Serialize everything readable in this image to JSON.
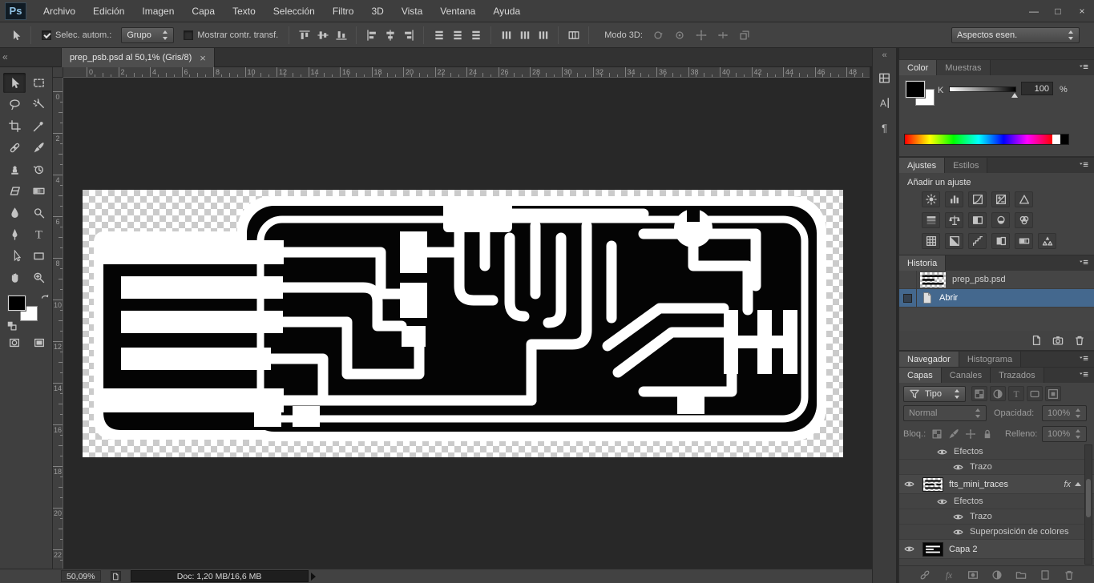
{
  "titlebar": {
    "logo": "Ps",
    "menus": [
      "Archivo",
      "Edición",
      "Imagen",
      "Capa",
      "Texto",
      "Selección",
      "Filtro",
      "3D",
      "Vista",
      "Ventana",
      "Ayuda"
    ],
    "controls": {
      "minimize": "—",
      "restore": "□",
      "close": "×"
    }
  },
  "options": {
    "auto_select_label": "Selec. autom.:",
    "auto_select_checked": true,
    "group_value": "Grupo",
    "show_transform_label": "Mostrar contr. transf.",
    "show_transform_checked": false,
    "align_icons": [
      "align-top",
      "align-middle",
      "align-bottom",
      "align-left",
      "align-center",
      "align-right",
      "dist-top",
      "dist-middle",
      "dist-bottom",
      "dist-left",
      "dist-center",
      "dist-right"
    ],
    "auto_align_icon": "auto-align",
    "mode3d_label": "Modo 3D:",
    "mode3d_icons": [
      "3d-orbit",
      "3d-roll",
      "3d-pan",
      "3d-slide",
      "3d-scale"
    ],
    "workspace_value": "Aspectos esen."
  },
  "doc_tab": {
    "title": "prep_psb.psd al 50,1% (Gris/8)",
    "close": "×"
  },
  "collapse_glyph": "«",
  "toolbar": {
    "tools": [
      "move",
      "marquee",
      "lasso",
      "wand",
      "crop",
      "eyedropper",
      "healing",
      "brush",
      "stamp",
      "history-brush",
      "eraser",
      "gradient",
      "blur",
      "dodge",
      "pen",
      "type",
      "path-select",
      "shape",
      "hand",
      "zoom"
    ],
    "bottom_icons": [
      "quick-mask",
      "screen-mode"
    ]
  },
  "rulers": {
    "horizontal": [
      "0",
      "2",
      "4",
      "6",
      "8",
      "10",
      "12",
      "14",
      "16",
      "18",
      "20",
      "22",
      "24",
      "26",
      "28",
      "30",
      "32",
      "34",
      "36",
      "38",
      "40",
      "42",
      "44",
      "46",
      "48"
    ],
    "vertical": [
      "0",
      "2",
      "4",
      "6",
      "8",
      "10",
      "12",
      "14",
      "16",
      "18",
      "20",
      "22"
    ]
  },
  "statusbar": {
    "zoom": "50,09%",
    "doc_info": "Doc: 1,20 MB/16,6 MB"
  },
  "dock_strip": {
    "icons": [
      "panel-grid",
      "character-panel",
      "paragraph-panel"
    ]
  },
  "color_panel": {
    "tabs": [
      "Color",
      "Muestras"
    ],
    "channel_label": "K",
    "value": "100",
    "unit": "%"
  },
  "adjustments_panel": {
    "tabs": [
      "Ajustes",
      "Estilos"
    ],
    "heading": "Añadir un ajuste",
    "icons_row1": [
      "brightness-contrast",
      "levels",
      "curves",
      "exposure",
      "vibrance"
    ],
    "icons_row2": [
      "hue-saturation",
      "color-balance",
      "black-white",
      "photo-filter",
      "channel-mixer"
    ],
    "icons_row3": [
      "color-lookup",
      "invert",
      "posterize",
      "threshold",
      "gradient-map",
      "selective-color"
    ]
  },
  "history_panel": {
    "title": "Historia",
    "items": [
      {
        "label": "prep_psb.psd",
        "type": "snapshot",
        "selected": false
      },
      {
        "label": "Abrir",
        "type": "state",
        "selected": true
      }
    ],
    "footer_icons": [
      "new-doc-from-state",
      "new-snapshot",
      "delete"
    ]
  },
  "navigator_bar": {
    "tabs": [
      "Navegador",
      "Histograma"
    ]
  },
  "layers_panel": {
    "tabs": [
      "Capas",
      "Canales",
      "Trazados"
    ],
    "filter": {
      "label": "Tipo",
      "icons": [
        "pixel-filter",
        "adjustment-filter",
        "type-filter",
        "shape-filter",
        "smart-filter"
      ]
    },
    "blend_mode": "Normal",
    "opacity_label": "Opacidad:",
    "opacity_value": "100%",
    "lock_label": "Bloq.:",
    "lock_icons": [
      "lock-transparent",
      "lock-pixels",
      "lock-position",
      "lock-all"
    ],
    "fill_label": "Relleno:",
    "fill_value": "100%",
    "fx_badge": "fx",
    "rows": [
      {
        "type": "effects",
        "label": "Efectos"
      },
      {
        "type": "effect-item",
        "label": "Trazo"
      },
      {
        "type": "layer",
        "label": "fts_mini_traces",
        "thumb": "traces",
        "fx": true
      },
      {
        "type": "effects",
        "label": "Efectos"
      },
      {
        "type": "effect-item",
        "label": "Trazo"
      },
      {
        "type": "effect-item",
        "label": "Superposición de colores"
      },
      {
        "type": "layer",
        "label": "Capa 2",
        "thumb": "dark",
        "fx": false
      }
    ],
    "footer_icons": [
      "link-layers",
      "layer-style",
      "layer-mask",
      "adjustment-layer",
      "layer-group",
      "new-layer",
      "delete-layer"
    ]
  }
}
